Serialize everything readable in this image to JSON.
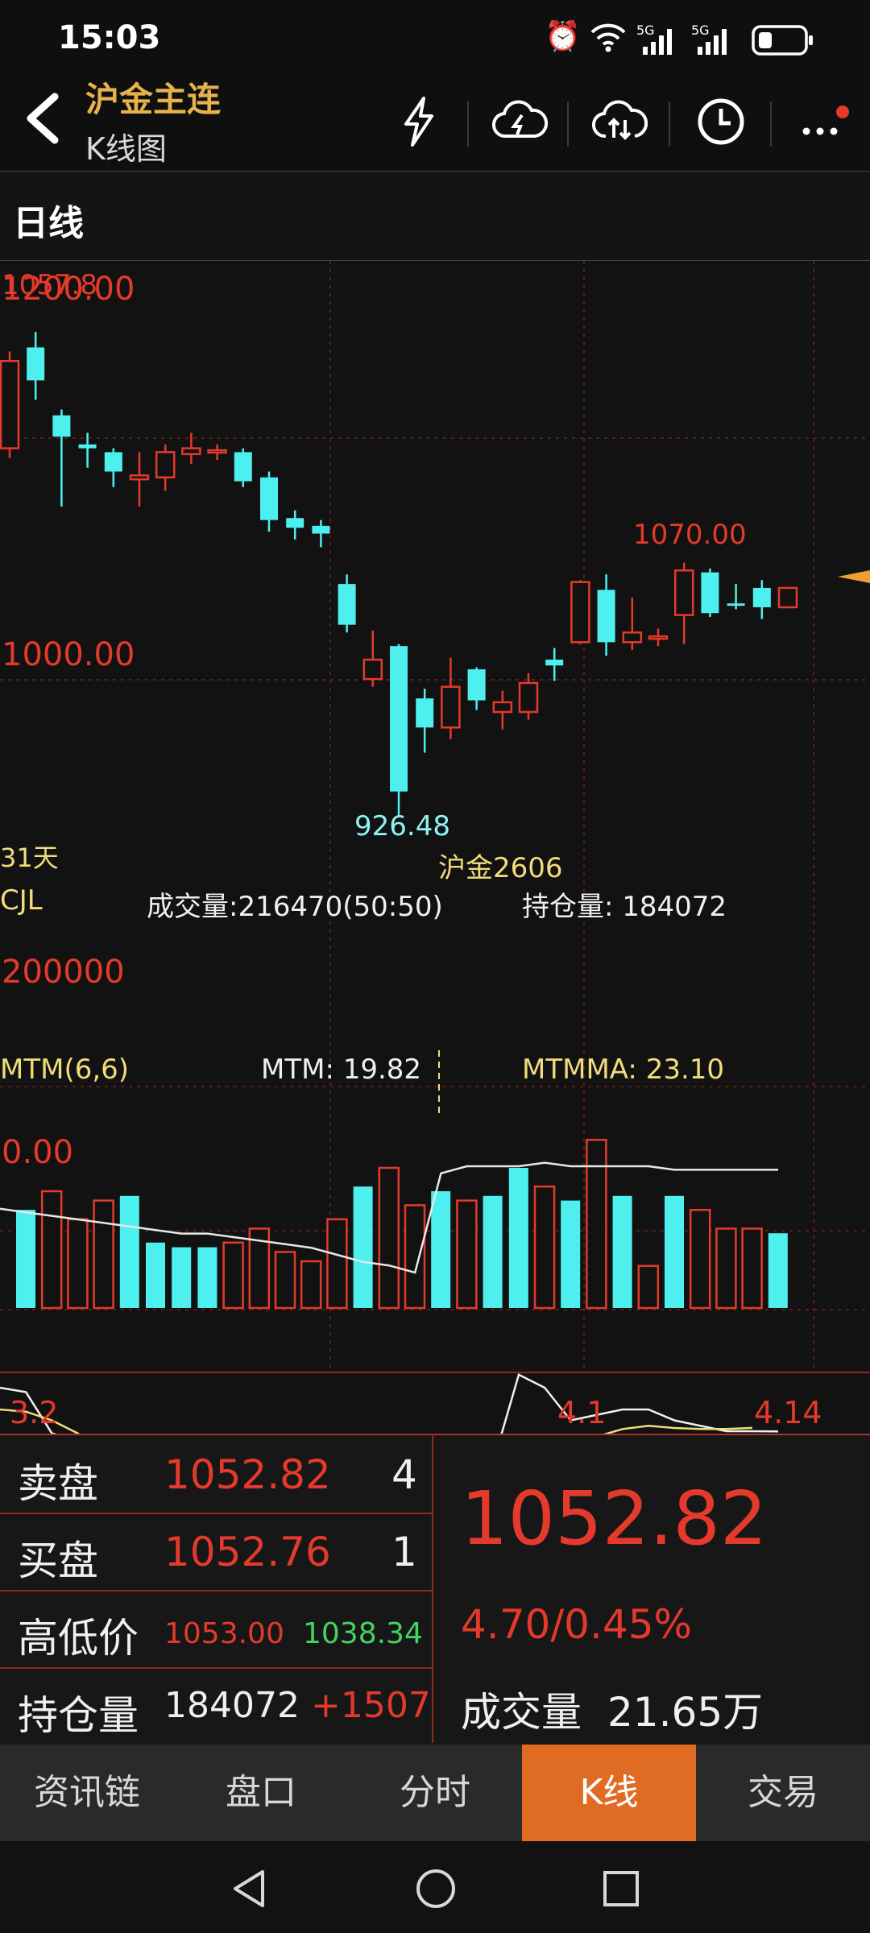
{
  "status": {
    "time": "15:03",
    "net1": "5G",
    "net2": "5G"
  },
  "header": {
    "title": "沪金主连",
    "subtitle": "K线图"
  },
  "tab": {
    "period": "日线"
  },
  "chart": {
    "label_high": "1070.00",
    "label_high_left": "1057.8",
    "label_low": "926.48",
    "axis_top": "1200.00",
    "axis_mid": "1000.00",
    "days": "31天",
    "contract": "沪金2606",
    "cjl_title": "CJL",
    "volume_text": "成交量:216470(50:50)",
    "oi_text": "持仓量: 184072",
    "vol_axis": "200000",
    "mtm_title": "MTM(6,6)",
    "mtm_text": "MTM: 19.82",
    "mtmma_text": "MTMMA: 23.10",
    "mtm_axis": "0.00",
    "dates": [
      "3.2",
      "4.1",
      "4.14"
    ]
  },
  "chart_data": {
    "type": "candlestick",
    "candles": [
      {
        "o": 1120,
        "c": 1165,
        "h": 1170,
        "l": 1115,
        "up": true
      },
      {
        "o": 1172,
        "c": 1155,
        "h": 1180,
        "l": 1145,
        "up": false
      },
      {
        "o": 1137,
        "c": 1126,
        "h": 1140,
        "l": 1090,
        "up": false
      },
      {
        "o": 1122,
        "c": 1120,
        "h": 1128,
        "l": 1110,
        "up": false
      },
      {
        "o": 1118,
        "c": 1108,
        "h": 1120,
        "l": 1100,
        "up": false
      },
      {
        "o": 1104,
        "c": 1106,
        "h": 1118,
        "l": 1090,
        "up": true
      },
      {
        "o": 1105,
        "c": 1118,
        "h": 1122,
        "l": 1098,
        "up": true
      },
      {
        "o": 1117,
        "c": 1120,
        "h": 1128,
        "l": 1112,
        "up": true
      },
      {
        "o": 1118,
        "c": 1119,
        "h": 1122,
        "l": 1114,
        "up": true
      },
      {
        "o": 1118,
        "c": 1103,
        "h": 1120,
        "l": 1100,
        "up": false
      },
      {
        "o": 1105,
        "c": 1083,
        "h": 1108,
        "l": 1077,
        "up": false
      },
      {
        "o": 1084,
        "c": 1079,
        "h": 1088,
        "l": 1073,
        "up": false
      },
      {
        "o": 1080,
        "c": 1076,
        "h": 1083,
        "l": 1069,
        "up": false
      },
      {
        "o": 1050,
        "c": 1029,
        "h": 1055,
        "l": 1025,
        "up": false
      },
      {
        "o": 1011,
        "c": 1001,
        "h": 1026,
        "l": 997,
        "up": true
      },
      {
        "o": 1018,
        "c": 943,
        "h": 1019,
        "l": 930,
        "up": false
      },
      {
        "o": 991,
        "c": 976,
        "h": 996,
        "l": 963,
        "up": false
      },
      {
        "o": 976,
        "c": 997,
        "h": 1012,
        "l": 970,
        "up": true
      },
      {
        "o": 1006,
        "c": 990,
        "h": 1007,
        "l": 985,
        "up": false
      },
      {
        "o": 984,
        "c": 989,
        "h": 995,
        "l": 975,
        "up": true
      },
      {
        "o": 984,
        "c": 999,
        "h": 1004,
        "l": 980,
        "up": true
      },
      {
        "o": 1011,
        "c": 1008,
        "h": 1017,
        "l": 1000,
        "up": false
      },
      {
        "o": 1020,
        "c": 1051,
        "h": 1052,
        "l": 1019,
        "up": true
      },
      {
        "o": 1047,
        "c": 1020,
        "h": 1055,
        "l": 1013,
        "up": false
      },
      {
        "o": 1020,
        "c": 1025,
        "h": 1043,
        "l": 1016,
        "up": true
      },
      {
        "o": 1023,
        "c": 1022,
        "h": 1027,
        "l": 1018,
        "up": true
      },
      {
        "o": 1034,
        "c": 1057,
        "h": 1061,
        "l": 1019,
        "up": true
      },
      {
        "o": 1056,
        "c": 1035,
        "h": 1058,
        "l": 1033,
        "up": false
      },
      {
        "o": 1040,
        "c": 1040,
        "h": 1050,
        "l": 1037,
        "up": false
      },
      {
        "o": 1048,
        "c": 1038,
        "h": 1052,
        "l": 1032,
        "up": false
      },
      {
        "o": 1038,
        "c": 1048,
        "h": 1048,
        "l": 1038,
        "up": true
      }
    ],
    "volumes": [
      {
        "v": 21,
        "up": true
      },
      {
        "v": 25,
        "up": false
      },
      {
        "v": 19,
        "up": false
      },
      {
        "v": 23,
        "up": false
      },
      {
        "v": 24,
        "up": true
      },
      {
        "v": 14,
        "up": true
      },
      {
        "v": 13,
        "up": true
      },
      {
        "v": 13,
        "up": true
      },
      {
        "v": 14,
        "up": false
      },
      {
        "v": 17,
        "up": false
      },
      {
        "v": 12,
        "up": false
      },
      {
        "v": 10,
        "up": false
      },
      {
        "v": 19,
        "up": false
      },
      {
        "v": 26,
        "up": true
      },
      {
        "v": 30,
        "up": false
      },
      {
        "v": 22,
        "up": false
      },
      {
        "v": 25,
        "up": true
      },
      {
        "v": 23,
        "up": false
      },
      {
        "v": 24,
        "up": true
      },
      {
        "v": 30,
        "up": true
      },
      {
        "v": 26,
        "up": false
      },
      {
        "v": 23,
        "up": true
      },
      {
        "v": 36,
        "up": false
      },
      {
        "v": 24,
        "up": true
      },
      {
        "v": 9,
        "up": false
      },
      {
        "v": 24,
        "up": true
      },
      {
        "v": 21,
        "up": false
      },
      {
        "v": 17,
        "up": false
      },
      {
        "v": 17,
        "up": false
      },
      {
        "v": 16,
        "up": true
      }
    ],
    "oi_line": [
      28,
      27,
      26,
      25,
      24,
      23,
      22,
      21,
      21,
      20,
      19,
      18,
      17,
      15,
      13,
      12,
      10,
      38,
      40,
      40,
      40,
      41,
      40,
      40,
      40,
      40,
      39,
      39,
      39,
      39,
      39
    ],
    "mtm": [
      60,
      56,
      18,
      12,
      -8,
      -8,
      -30,
      -10,
      -16,
      -20,
      -20,
      -20,
      -25,
      -78,
      -100,
      -60,
      -54,
      -65,
      -50,
      -10,
      72,
      60,
      30,
      35,
      40,
      40,
      30,
      25,
      20,
      20,
      19.82
    ],
    "mtmma": [
      40,
      38,
      30,
      18,
      -6,
      -15,
      -16,
      -20,
      -22,
      -24,
      -26,
      -30,
      -40,
      -55,
      -70,
      -75,
      -80,
      -82,
      -78,
      -60,
      -30,
      -10,
      5,
      15,
      22,
      25,
      23,
      22,
      22,
      23.1
    ]
  },
  "panel": {
    "sell_label": "卖盘",
    "sell_price": "1052.82",
    "sell_qty": "4",
    "buy_label": "买盘",
    "buy_price": "1052.76",
    "buy_qty": "1",
    "hl_label": "高低价",
    "high": "1053.00",
    "low": "1038.34",
    "oi_label": "持仓量",
    "oi": "184072",
    "oi_change": "+1507",
    "last": "1052.82",
    "change": "4.70/0.45%",
    "vol_label": "成交量",
    "vol": "21.65万"
  },
  "nav": [
    "资讯链",
    "盘口",
    "分时",
    "K线",
    "交易"
  ],
  "colors": {
    "up": "#e33a2b",
    "down": "#4ef0ef",
    "accent": "#e06c24",
    "title": "#e6b24b",
    "yellow": "#f3dc7a"
  }
}
